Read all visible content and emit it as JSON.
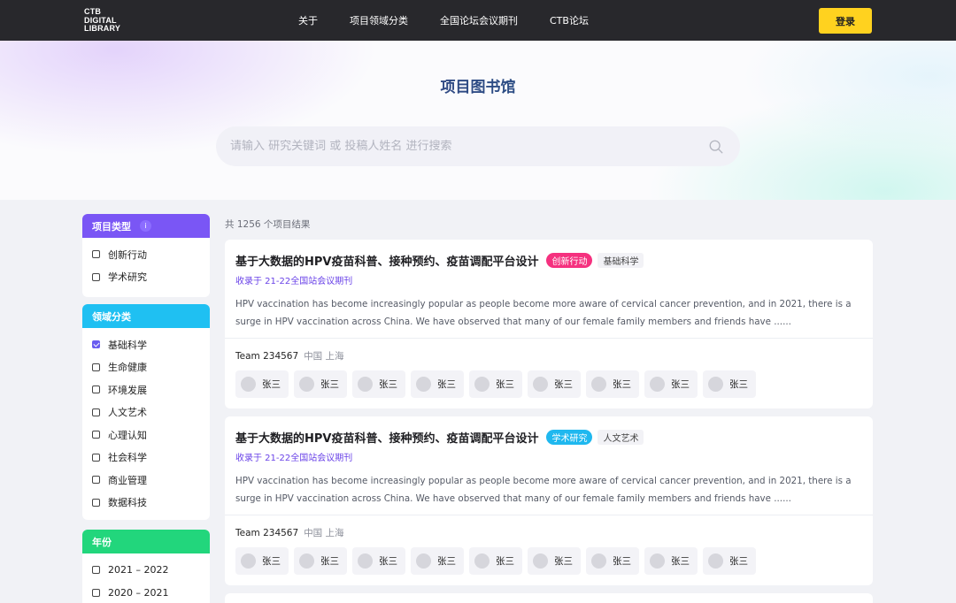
{
  "nav": {
    "logo_lines": [
      "CTB",
      "DIGITAL",
      "LIBRARY"
    ],
    "links": [
      "关于",
      "项目领域分类",
      "全国论坛会议期刊",
      "CTB论坛"
    ],
    "login": "登录"
  },
  "hero": {
    "title": "项目图书馆",
    "search_placeholder": "请输入 研究关键词 或 投稿人姓名 进行搜索"
  },
  "filters": {
    "type": {
      "title": "项目类型",
      "info": "i",
      "color": "#7a56f5",
      "items": [
        {
          "label": "创新行动",
          "checked": false
        },
        {
          "label": "学术研究",
          "checked": false
        }
      ]
    },
    "field": {
      "title": "领域分类",
      "color": "#1fc0f2",
      "items": [
        {
          "label": "基础科学",
          "checked": true
        },
        {
          "label": "生命健康",
          "checked": false
        },
        {
          "label": "环境发展",
          "checked": false
        },
        {
          "label": "人文艺术",
          "checked": false
        },
        {
          "label": "心理认知",
          "checked": false
        },
        {
          "label": "社会科学",
          "checked": false
        },
        {
          "label": "商业管理",
          "checked": false
        },
        {
          "label": "数据科技",
          "checked": false
        }
      ]
    },
    "year": {
      "title": "年份",
      "color": "#22d67c",
      "items": [
        {
          "label": "2021 – 2022",
          "checked": false
        },
        {
          "label": "2020 – 2021",
          "checked": false
        }
      ]
    }
  },
  "results": {
    "count_text": "共 1256 个项目结果",
    "cards": [
      {
        "title": "基于大数据的HPV疫苗科普、接种预约、疫苗调配平台设计",
        "type_tag": "创新行动",
        "type_color": "#f5317f",
        "field_tag": "基础科学",
        "source": "收录于 21-22全国站会议期刊",
        "abstract": "HPV vaccination has become increasingly popular as people become more aware of cervical cancer prevention, and in 2021, there is a surge in HPV vaccination across China. We have observed that many of our female family members and friends have ......",
        "team": "Team 234567",
        "location": "中国 上海",
        "members": [
          "张三",
          "张三",
          "张三",
          "张三",
          "张三",
          "张三",
          "张三",
          "张三",
          "张三"
        ]
      },
      {
        "title": "基于大数据的HPV疫苗科普、接种预约、疫苗调配平台设计",
        "type_tag": "学术研究",
        "type_color": "#1fb8ef",
        "field_tag": "人文艺术",
        "source": "收录于 21-22全国站会议期刊",
        "abstract": "HPV vaccination has become increasingly popular as people become more aware of cervical cancer prevention, and in 2021, there is a surge in HPV vaccination across China. We have observed that many of our female family members and friends have ......",
        "team": "Team 234567",
        "location": "中国 上海",
        "members": [
          "张三",
          "张三",
          "张三",
          "张三",
          "张三",
          "张三",
          "张三",
          "张三",
          "张三"
        ]
      }
    ]
  }
}
